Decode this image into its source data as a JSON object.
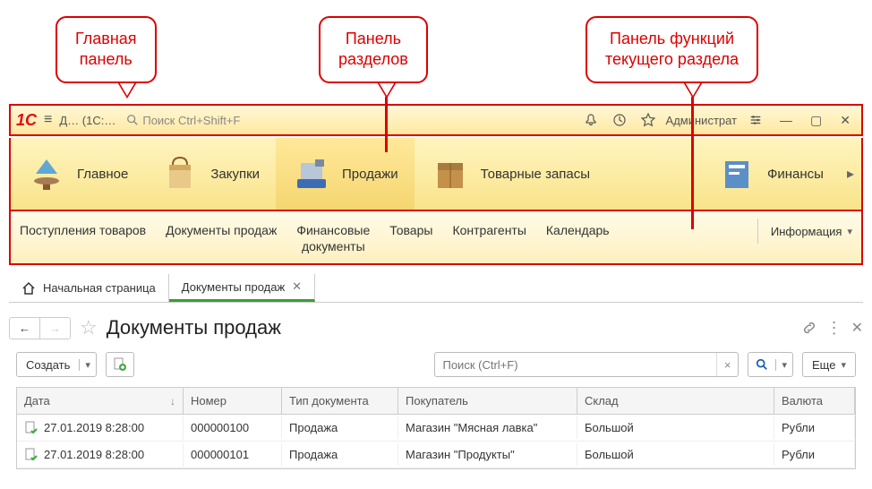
{
  "callouts": {
    "main_panel": "Главная\nпанель",
    "sections_panel": "Панель\nразделов",
    "functions_panel": "Панель функций\nтекущего раздела"
  },
  "toolbar": {
    "app_title": "Д… (1С:…",
    "search_placeholder": "Поиск Ctrl+Shift+F",
    "user": "Администрат"
  },
  "sections": [
    {
      "label": "Главное"
    },
    {
      "label": "Закупки"
    },
    {
      "label": "Продажи"
    },
    {
      "label": "Товарные запасы"
    },
    {
      "label": "Финансы"
    }
  ],
  "functions": [
    "Поступления товаров",
    "Документы продаж",
    "Финансовые\nдокументы",
    "Товары",
    "Контрагенты",
    "Календарь"
  ],
  "functions_dropdown": "Информация",
  "tabs": {
    "home": "Начальная страница",
    "active": "Документы продаж"
  },
  "page": {
    "title": "Документы продаж",
    "create_button": "Создать",
    "search_placeholder": "Поиск (Ctrl+F)",
    "more_button": "Еще"
  },
  "table": {
    "columns": [
      "Дата",
      "Номер",
      "Тип документа",
      "Покупатель",
      "Склад",
      "Валюта"
    ],
    "rows": [
      {
        "date": "27.01.2019 8:28:00",
        "num": "000000100",
        "type": "Продажа",
        "buyer": "Магазин \"Мясная лавка\"",
        "wh": "Большой",
        "cur": "Рубли"
      },
      {
        "date": "27.01.2019 8:28:00",
        "num": "000000101",
        "type": "Продажа",
        "buyer": "Магазин \"Продукты\"",
        "wh": "Большой",
        "cur": "Рубли"
      }
    ]
  }
}
